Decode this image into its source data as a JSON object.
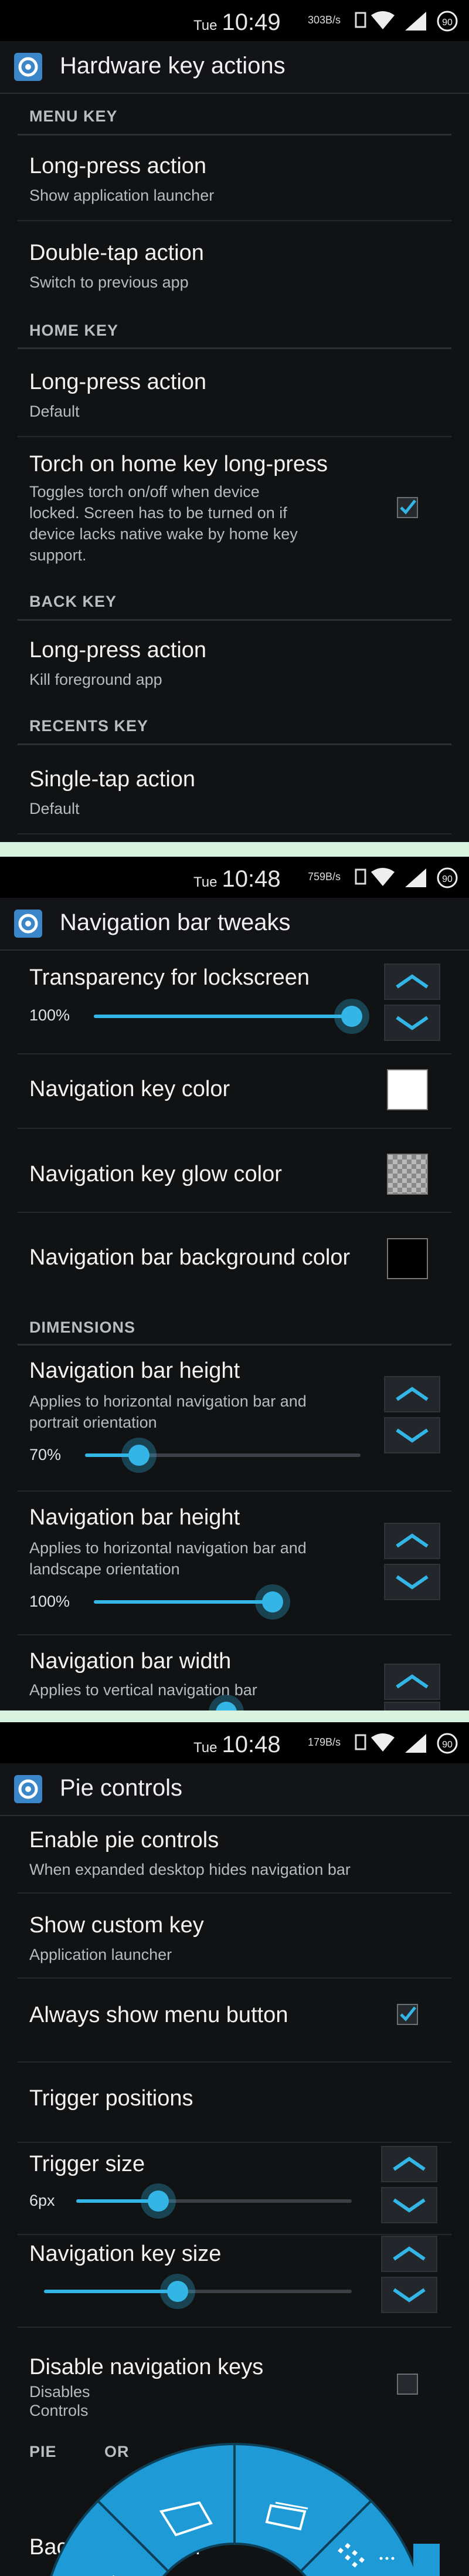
{
  "screens": [
    {
      "status": {
        "day": "Tue",
        "time": "10:49",
        "speed": "303B/s"
      },
      "title": "Hardware key actions",
      "menu_key": {
        "header": "MENU KEY",
        "long_press": {
          "title": "Long-press action",
          "summary": "Show application launcher"
        },
        "double_tap": {
          "title": "Double-tap action",
          "summary": "Switch to previous app"
        }
      },
      "home_key": {
        "header": "HOME KEY",
        "long_press": {
          "title": "Long-press action",
          "summary": "Default"
        },
        "torch": {
          "title": "Torch on home key long-press",
          "summary_lines": [
            "Toggles torch on/off when device",
            "locked. Screen has to be turned on if",
            "device lacks native wake by home key",
            "support."
          ],
          "checked": true
        }
      },
      "back_key": {
        "header": "BACK KEY",
        "long_press": {
          "title": "Long-press action",
          "summary": "Kill foreground app"
        }
      },
      "recents_key": {
        "header": "RECENTS KEY",
        "single_tap": {
          "title": "Single-tap action",
          "summary": "Default"
        }
      }
    },
    {
      "status": {
        "day": "Tue",
        "time": "10:48",
        "speed": "759B/s"
      },
      "title": "Navigation bar tweaks",
      "transparency": {
        "title": "Transparency for lockscreen",
        "value_label": "100%",
        "value": 1.0
      },
      "key_color": {
        "title": "Navigation key color",
        "color": "#ffffff"
      },
      "glow_color": {
        "title": "Navigation key glow color",
        "color": "transparent"
      },
      "bg_color": {
        "title": "Navigation bar background color",
        "color": "#000000"
      },
      "dimensions_header": "DIMENSIONS",
      "height_portrait": {
        "title": "Navigation bar height",
        "summary_lines": [
          "Applies to horizontal navigation bar and",
          "portrait orientation"
        ],
        "value_label": "70%",
        "value": 0.7
      },
      "height_landscape": {
        "title": "Navigation bar height",
        "summary_lines": [
          "Applies to horizontal navigation bar and",
          "landscape orientation"
        ],
        "value_label": "100%",
        "value": 1.0
      },
      "width": {
        "title": "Navigation bar width",
        "summary": "Applies to vertical navigation bar"
      }
    },
    {
      "status": {
        "day": "Tue",
        "time": "10:48",
        "speed": "179B/s"
      },
      "title": "Pie controls",
      "enable": {
        "title": "Enable pie controls",
        "summary": "When expanded desktop hides navigation bar"
      },
      "custom_key": {
        "title": "Show custom key",
        "summary": "Application launcher"
      },
      "menu_button": {
        "title": "Always show menu button",
        "checked": true
      },
      "trigger_positions": {
        "title": "Trigger positions"
      },
      "trigger_size": {
        "title": "Trigger size",
        "value_label": "6px"
      },
      "key_size": {
        "title": "Navigation key size"
      },
      "disable_nav_keys": {
        "title": "Disable navigation keys",
        "summary_fragments": [
          "Disables",
          "Controls"
        ],
        "checked": false
      },
      "pie_header_fragment": "PIE",
      "pie_header_suffix_fragment": "OR",
      "background_color": {
        "title": "Background color"
      }
    }
  ],
  "accent_color": "#33b5e5",
  "icons": [
    "settings-app-icon",
    "sim-icon",
    "wifi-icon",
    "signal-icon",
    "battery-icon",
    "checkbox-icon",
    "step-up-icon",
    "step-down-icon",
    "back-icon",
    "home-icon",
    "recents-icon",
    "menu-icon",
    "search-icon"
  ]
}
